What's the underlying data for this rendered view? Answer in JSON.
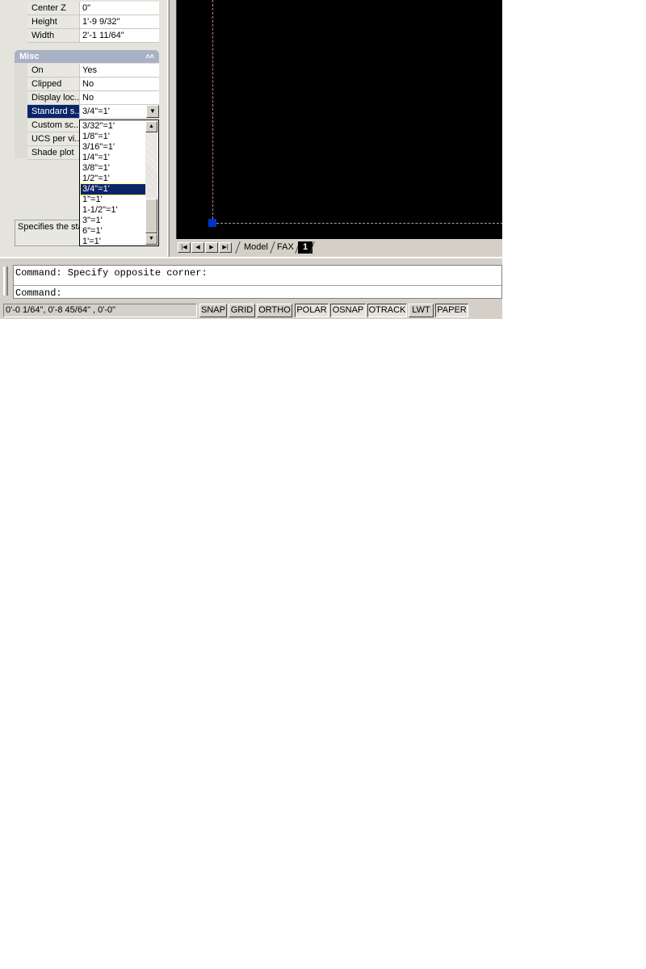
{
  "properties": {
    "rows_top": [
      {
        "name": "Center Z",
        "value": "0\""
      },
      {
        "name": "Height",
        "value": "1'-9 9/32\""
      },
      {
        "name": "Width",
        "value": "2'-1 11/64\""
      }
    ],
    "misc_header": "Misc",
    "rows_misc": [
      {
        "name": "On",
        "value": "Yes"
      },
      {
        "name": "Clipped",
        "value": "No"
      },
      {
        "name": "Display loc...",
        "value": "No"
      },
      {
        "name": "Standard s...",
        "value": "3/4\"=1'"
      },
      {
        "name": "Custom sc...",
        "value": ""
      },
      {
        "name": "UCS per vi...",
        "value": ""
      },
      {
        "name": "Shade plot",
        "value": ""
      }
    ],
    "description": "Specifies the sta viewport"
  },
  "dropdown": {
    "items": [
      "3/32\"=1'",
      "1/8\"=1'",
      "3/16\"=1'",
      "1/4\"=1'",
      "3/8\"=1'",
      "1/2\"=1'",
      "3/4\"=1'",
      "1\"=1'",
      "1-1/2\"=1'",
      "3\"=1'",
      "6\"=1'",
      "1'=1'"
    ],
    "selected": "3/4\"=1'"
  },
  "layout_tabs": [
    "Model",
    "FAX",
    "1"
  ],
  "command": {
    "line1": "Command: Specify opposite corner:",
    "line2": "Command:"
  },
  "status": {
    "coords": "0'-0 1/64\",  0'-8 45/64\" , 0'-0\"",
    "buttons": [
      "SNAP",
      "GRID",
      "ORTHO",
      "POLAR",
      "OSNAP",
      "OTRACK",
      "LWT",
      "PAPER"
    ],
    "on_buttons": [
      "POLAR",
      "OSNAP",
      "OTRACK",
      "PAPER"
    ]
  },
  "colors": {
    "selection": "#0a246a",
    "canvas": "#000000",
    "grip": "#0033cc",
    "misc_header": "#a9b2c4"
  }
}
